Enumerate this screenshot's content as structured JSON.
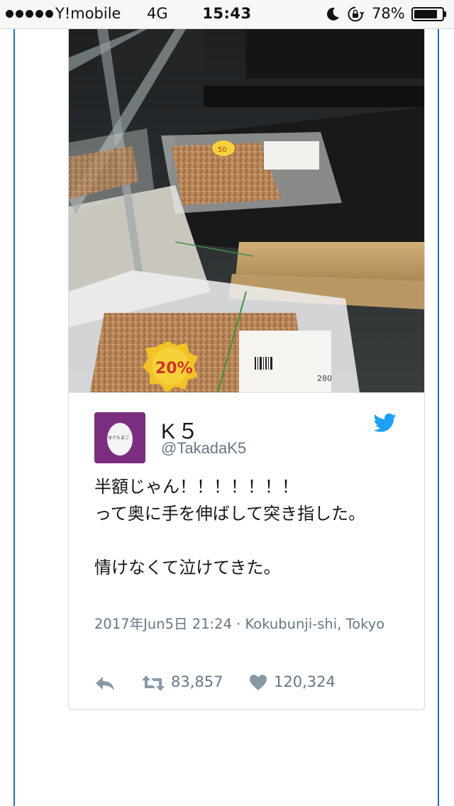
{
  "status_bar": {
    "carrier": "Y!mobile",
    "network": "4G",
    "time": "15:43",
    "battery_percent": "78%",
    "icons": [
      "signal-dots-icon",
      "moon-icon",
      "rotation-lock-icon",
      "battery-icon"
    ]
  },
  "tweet": {
    "photo": {
      "price_sticker_back": "50",
      "price_sticker_front": "20%",
      "label_price": "280"
    },
    "avatar_text": "ゆでたまご",
    "display_name": "K５",
    "screen_name": "@TakadaK5",
    "text": "半額じゃん！！！！！！！\nって奥に手を伸ばして突き指した。\n\n情けなくて泣けてきた。",
    "meta": "2017年Jun5日 21:24 · Kokubunji-shi, Tokyo",
    "retweet_count": "83,857",
    "like_count": "120,324",
    "colors": {
      "link_blue": "#1da1f2",
      "meta_gray": "#657786",
      "avatar_purple": "#7b2e7f",
      "frame_blue": "#1f6fb8"
    }
  }
}
